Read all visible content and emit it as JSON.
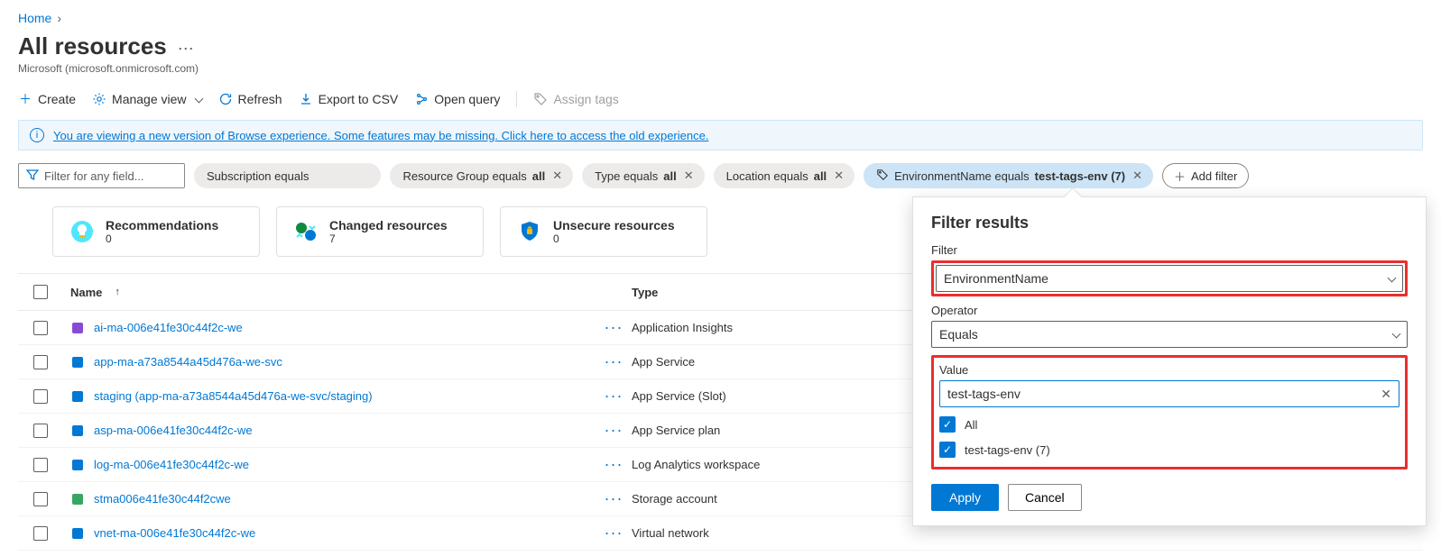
{
  "breadcrumb": {
    "home": "Home"
  },
  "page": {
    "title": "All resources",
    "subtitle": "Microsoft (microsoft.onmicrosoft.com)"
  },
  "toolbar": {
    "create": "Create",
    "manage_view": "Manage view",
    "refresh": "Refresh",
    "export_csv": "Export to CSV",
    "open_query": "Open query",
    "assign_tags": "Assign tags"
  },
  "info": {
    "message": "You are viewing a new version of Browse experience. Some features may be missing. Click here to access the old experience."
  },
  "filters": {
    "input_placeholder": "Filter for any field...",
    "pills": {
      "subscription": {
        "label": "Subscription equals",
        "value": ""
      },
      "resource_group": {
        "label": "Resource Group equals ",
        "value": "all"
      },
      "type": {
        "label": "Type equals ",
        "value": "all"
      },
      "location": {
        "label": "Location equals ",
        "value": "all"
      },
      "env": {
        "label": "EnvironmentName equals ",
        "value": "test-tags-env (7)"
      },
      "add": "Add filter"
    }
  },
  "cards": {
    "recommendations": {
      "title": "Recommendations",
      "count": "0"
    },
    "changed": {
      "title": "Changed resources",
      "count": "7"
    },
    "unsecure": {
      "title": "Unsecure resources",
      "count": "0"
    }
  },
  "table": {
    "headers": {
      "name": "Name",
      "type": "Type"
    },
    "rows": [
      {
        "icon": "#8a4bd4",
        "name": "ai-ma-006e41fe30c44f2c-we",
        "type": "Application Insights"
      },
      {
        "icon": "#0078d4",
        "name": "app-ma-a73a8544a45d476a-we-svc",
        "type": "App Service"
      },
      {
        "icon": "#0078d4",
        "name": "staging (app-ma-a73a8544a45d476a-we-svc/staging)",
        "type": "App Service (Slot)"
      },
      {
        "icon": "#0078d4",
        "name": "asp-ma-006e41fe30c44f2c-we",
        "type": "App Service plan"
      },
      {
        "icon": "#0078d4",
        "name": "log-ma-006e41fe30c44f2c-we",
        "type": "Log Analytics workspace"
      },
      {
        "icon": "#37a660",
        "name": "stma006e41fe30c44f2cwe",
        "type": "Storage account"
      },
      {
        "icon": "#0078d4",
        "name": "vnet-ma-006e41fe30c44f2c-we",
        "type": "Virtual network"
      }
    ]
  },
  "panel": {
    "title": "Filter results",
    "filter_label": "Filter",
    "filter_value": "EnvironmentName",
    "operator_label": "Operator",
    "operator_value": "Equals",
    "value_label": "Value",
    "value_value": "test-tags-env",
    "opt_all": "All",
    "opt_env": "test-tags-env (7)",
    "apply": "Apply",
    "cancel": "Cancel"
  }
}
